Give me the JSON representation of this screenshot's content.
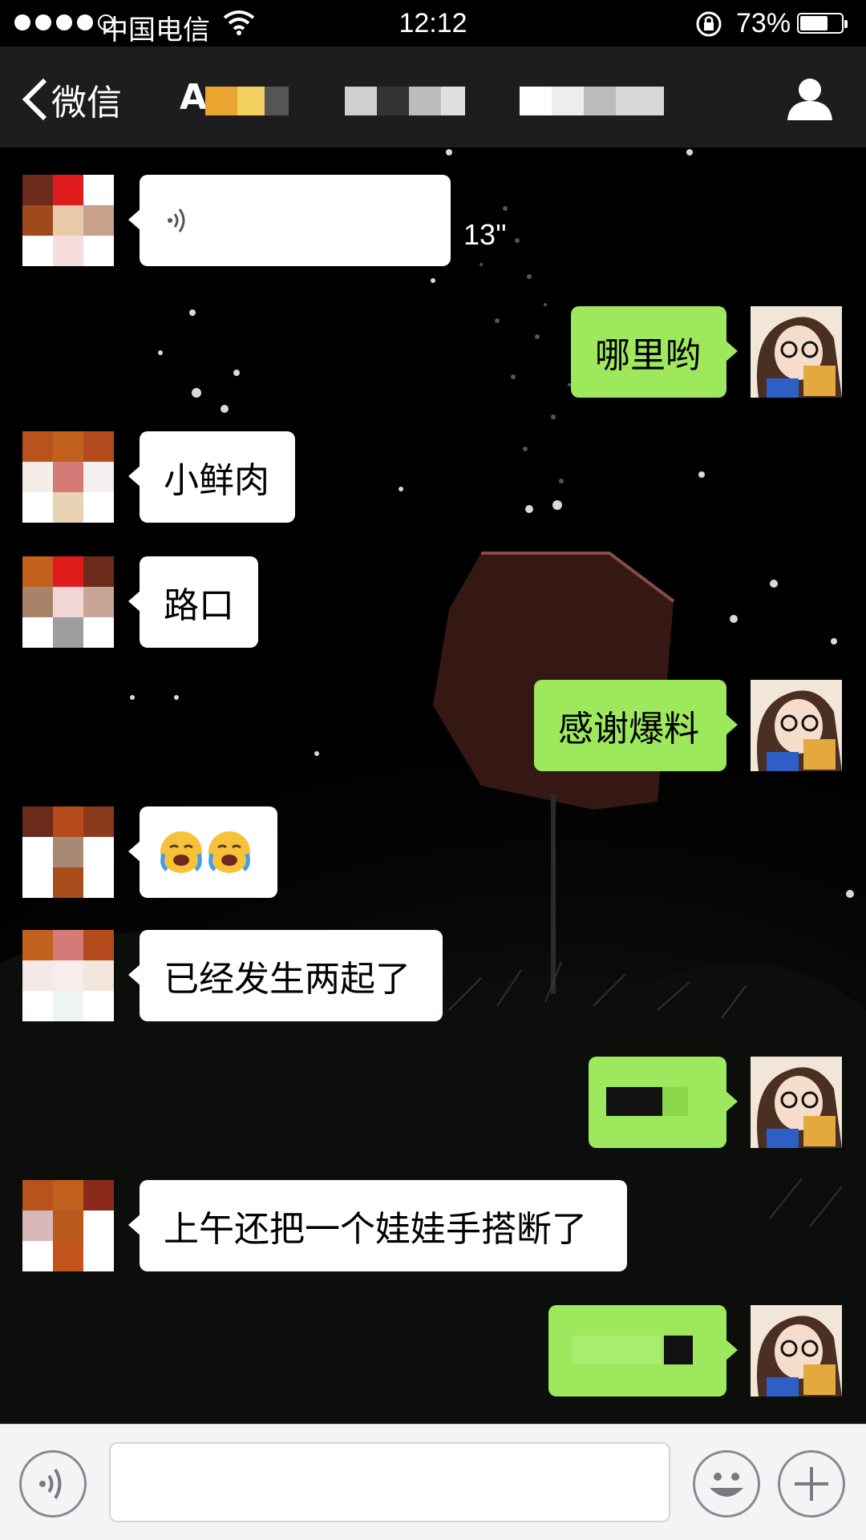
{
  "status_bar": {
    "carrier": "中国电信",
    "time": "12:12",
    "battery_percent": "73%",
    "battery_level": 0.73,
    "signal_bars": 4
  },
  "nav": {
    "back_label": "微信",
    "title_prefix": "A"
  },
  "messages": [
    {
      "from": "other",
      "type": "voice",
      "duration": "13''"
    },
    {
      "from": "self",
      "type": "text",
      "text": "哪里哟"
    },
    {
      "from": "other",
      "type": "text",
      "text": "小鲜肉"
    },
    {
      "from": "other",
      "type": "text",
      "text": "路口"
    },
    {
      "from": "self",
      "type": "text",
      "text": "感谢爆料"
    },
    {
      "from": "other",
      "type": "emoji",
      "emoji": [
        "face-with-tears-icon",
        "face-with-tears-icon"
      ]
    },
    {
      "from": "other",
      "type": "text",
      "text": "已经发生两起了"
    },
    {
      "from": "self",
      "type": "redacted"
    },
    {
      "from": "other",
      "type": "text",
      "text": "上午还把一个娃娃手搭断了"
    },
    {
      "from": "self",
      "type": "redacted"
    }
  ],
  "colors": {
    "outgoing_bubble": "#9de85d",
    "incoming_bubble": "#ffffff",
    "nav_background": "#1d1d1f",
    "input_bar": "#f4f4f6"
  },
  "icons": {
    "back": "chevron-left-icon",
    "profile": "person-icon",
    "voice_toggle": "voice-icon",
    "emoji": "smiley-icon",
    "more": "plus-icon"
  }
}
